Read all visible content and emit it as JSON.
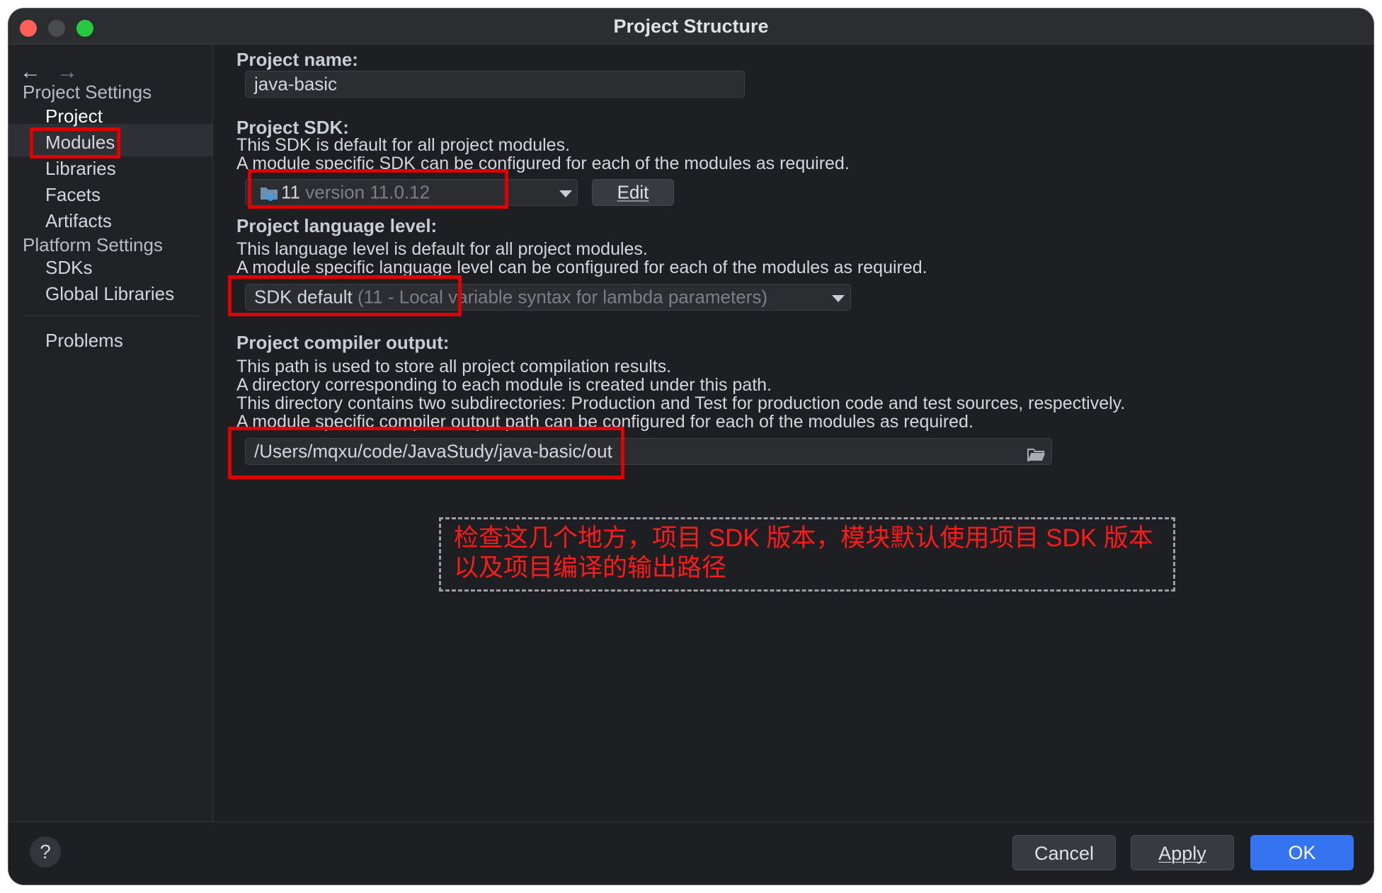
{
  "window": {
    "title": "Project Structure"
  },
  "sidebar": {
    "project_settings": "Project Settings",
    "project_items": [
      "Project",
      "Modules",
      "Libraries",
      "Facets",
      "Artifacts"
    ],
    "platform_settings": "Platform Settings",
    "platform_items": [
      "SDKs",
      "Global Libraries"
    ],
    "problems": "Problems"
  },
  "project_name": {
    "label": "Project name:",
    "value": "java-basic"
  },
  "project_sdk": {
    "label": "Project SDK:",
    "desc1": "This SDK is default for all project modules.",
    "desc2": "A module specific SDK can be configured for each of the modules as required.",
    "selected_name": "11",
    "selected_version": "version 11.0.12",
    "edit_label": "Edit"
  },
  "language_level": {
    "label": "Project language level:",
    "desc1": "This language level is default for all project modules.",
    "desc2": "A module specific language level can be configured for each of the modules as required.",
    "selected": "SDK default",
    "selected_detail": "(11 - Local variable syntax for lambda parameters)"
  },
  "compiler_output": {
    "label": "Project compiler output:",
    "desc1": "This path is used to store all project compilation results.",
    "desc2": "A directory corresponding to each module is created under this path.",
    "desc3": "This directory contains two subdirectories: Production and Test for production code and test sources, respectively.",
    "desc4": "A module specific compiler output path can be configured for each of the modules as required.",
    "path": "/Users/mqxu/code/JavaStudy/java-basic/out"
  },
  "annotation": {
    "line1": "检查这几个地方，项目 SDK 版本，模块默认使用项目 SDK 版本",
    "line2": "以及项目编译的输出路径"
  },
  "footer": {
    "help": "?",
    "cancel": "Cancel",
    "apply": "Apply",
    "ok": "OK"
  },
  "colors": {
    "highlight_red": "#e00000",
    "annotation_text": "#ff1a1a",
    "ok_button": "#3574f0"
  }
}
